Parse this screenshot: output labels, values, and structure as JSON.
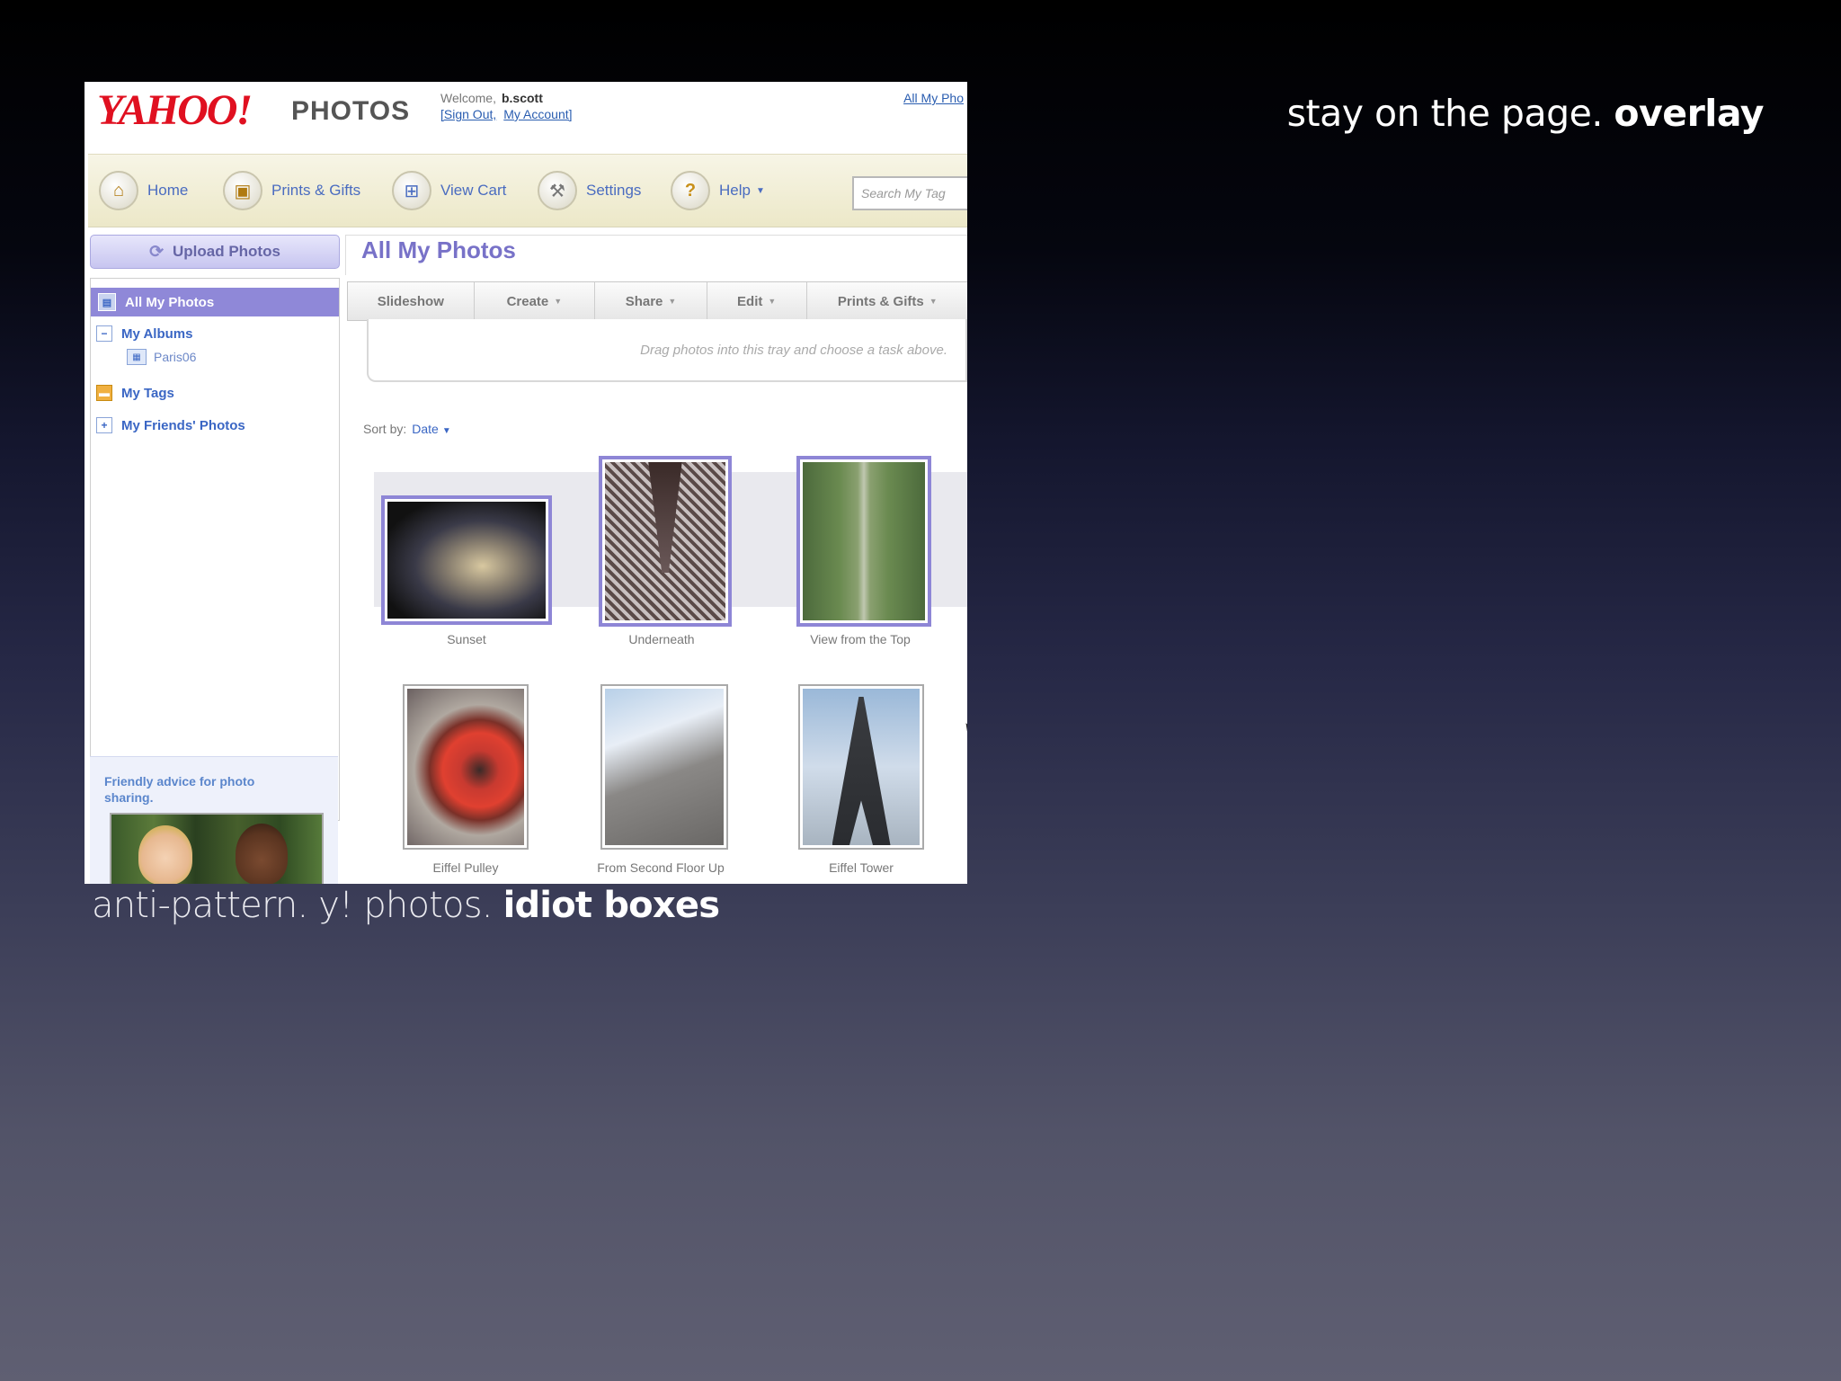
{
  "slide": {
    "title_plain": "stay on the page. ",
    "title_bold": "overlay",
    "caption_plain": "anti-pattern. y! photos. ",
    "caption_bold": "idiot boxes"
  },
  "app": {
    "logo": "YAHOO!",
    "logo_sub": "PHOTOS",
    "welcome_label": "Welcome,",
    "username": "b.scott",
    "sign_out": "[Sign Out,",
    "my_account": "My Account]",
    "top_right_link": "All My Pho"
  },
  "nav": {
    "items": [
      {
        "label": "Home",
        "icon": "home-icon"
      },
      {
        "label": "Prints & Gifts",
        "icon": "gift-icon"
      },
      {
        "label": "View Cart",
        "icon": "cart-icon"
      },
      {
        "label": "Settings",
        "icon": "wrench-icon"
      },
      {
        "label": "Help",
        "icon": "help-icon"
      }
    ],
    "search_placeholder": "Search My Tag"
  },
  "sidebar": {
    "upload_label": "Upload Photos",
    "active_item": "All My Photos",
    "items": [
      {
        "label": "My Albums"
      },
      {
        "label": "Paris06"
      },
      {
        "label": "My Tags"
      },
      {
        "label": "My Friends' Photos"
      }
    ],
    "advice_text": "Friendly advice for photo sharing."
  },
  "main": {
    "title": "All My Photos",
    "toolbar": [
      "Slideshow",
      "Create",
      "Share",
      "Edit",
      "Prints & Gifts"
    ],
    "tray_text": "Drag photos into this tray and choose a task above.",
    "sort_label": "Sort by:",
    "sort_value": "Date",
    "photos": [
      {
        "caption": "Sunset",
        "selected": true
      },
      {
        "caption": "Underneath",
        "selected": true
      },
      {
        "caption": "View from the Top",
        "selected": true
      },
      {
        "caption": "Eiffel Pulley",
        "selected": false
      },
      {
        "caption": "From Second Floor Up",
        "selected": false
      },
      {
        "caption": "Eiffel Tower",
        "selected": false
      }
    ]
  },
  "colors": {
    "selection": "#8e86d6",
    "link": "#3a66c4",
    "brand_red": "#e01020"
  }
}
